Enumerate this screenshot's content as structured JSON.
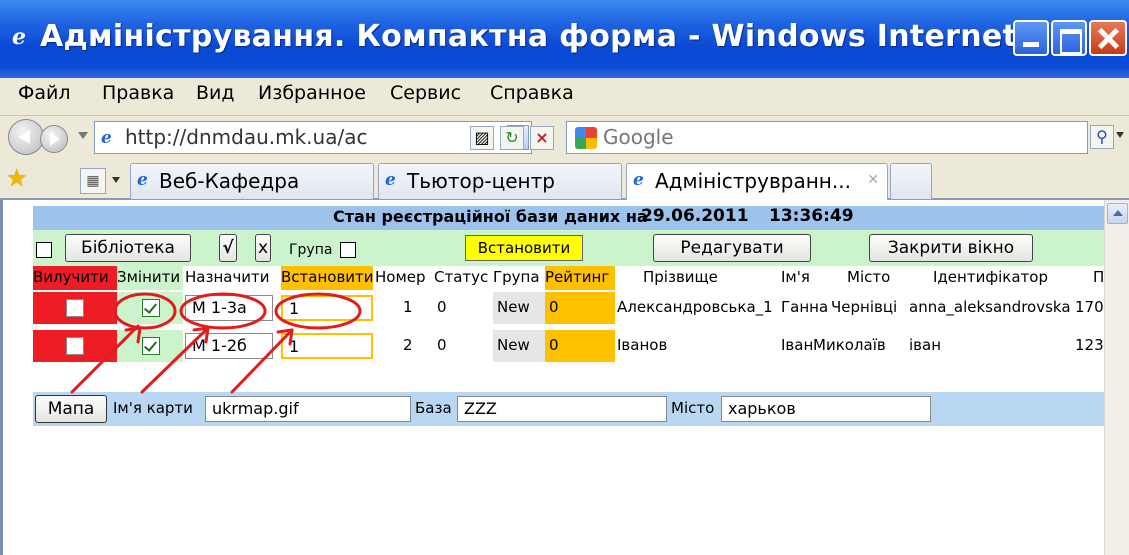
{
  "window": {
    "title": "Адміністрування. Компактна форма - Windows Internet E..."
  },
  "menu": [
    "Файл",
    "Правка",
    "Вид",
    "Избранное",
    "Сервис",
    "Справка"
  ],
  "address": {
    "url": "http://dnmdau.mk.ua/ac",
    "search_placeholder": "Google"
  },
  "tabs": [
    {
      "label": "Веб-Кафедра",
      "active": false
    },
    {
      "label": "Тьютор-центр",
      "active": false
    },
    {
      "label": "Адмініструвранн...",
      "active": true
    }
  ],
  "status": {
    "label": "Стан реєстраційної бази даних на",
    "date": "29.06.2011",
    "time": "13:36:49"
  },
  "controls": {
    "library": "Бібліотека",
    "check_all": "√",
    "uncheck_all": "x",
    "group_label": "Група",
    "set": "Встановити",
    "edit": "Редагувати",
    "close": "Закрити вікно"
  },
  "headers": {
    "delete": "Вилучити",
    "change": "Змінити",
    "assign": "Назначити",
    "set": "Встановити",
    "number": "Номер",
    "status": "Статус",
    "group": "Група",
    "rating": "Рейтинг",
    "surname": "Прізвище",
    "name": "Ім'я",
    "city": "Місто",
    "identifier": "Ідентифікатор",
    "extra": "П"
  },
  "rows": [
    {
      "assign": "М 1-3а",
      "set": "1",
      "number": "1",
      "status": "0",
      "group": "New",
      "rating": "0",
      "surname": "Александровська_1",
      "name": "Ганна",
      "city": "Чернівці",
      "identifier": "anna_aleksandrovska",
      "extra": "170",
      "change_checked": true
    },
    {
      "assign": "М 1-2б",
      "set": "1",
      "number": "2",
      "status": "0",
      "group": "New",
      "rating": "0",
      "surname": "Іванов",
      "name": "Іван",
      "city": "Миколаїв",
      "identifier": "іван",
      "extra": "123",
      "change_checked": true
    }
  ],
  "map": {
    "button": "Мапа",
    "map_name_label": "Ім'я карти",
    "map_name_value": "ukrmap.gif",
    "base_label": "База",
    "base_value": "ZZZ",
    "city_label": "Місто",
    "city_value": "харьков"
  },
  "colors": {
    "title_bar": "#0a49d6",
    "status_row": "#9dc3ec",
    "control_row": "#ccf4cc",
    "delete_red": "#ee1c24",
    "set_orange": "#ffc000",
    "set_yellow": "#ffff00",
    "annotation_red": "#e21b1b"
  }
}
